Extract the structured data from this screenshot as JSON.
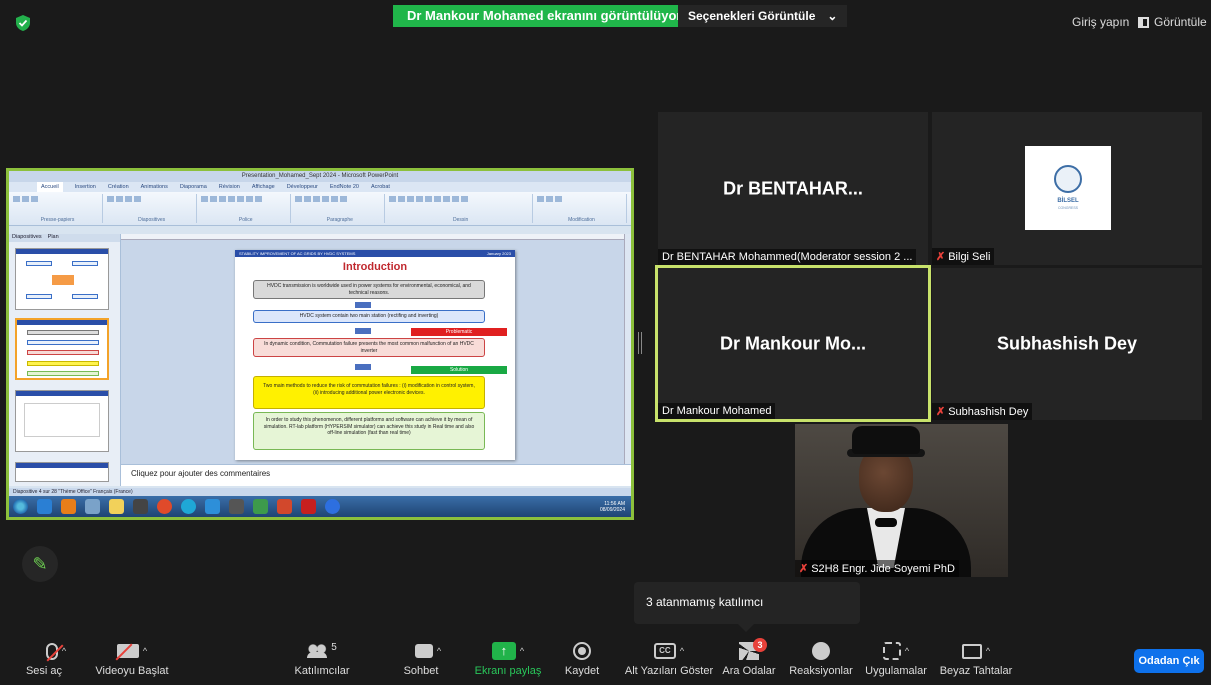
{
  "top_bar": {
    "share_banner": "Dr Mankour Mohamed ekranını görüntülüyorsunuz",
    "view_options": "Seçenekleri Görüntüle",
    "sign_in": "Giriş yapın",
    "view": "Görüntüle"
  },
  "shared_screen": {
    "window_title": "Presentation_Mohamed_Sept 2024 - Microsoft PowerPoint",
    "ribbon_tabs": [
      "Accueil",
      "Insertion",
      "Création",
      "Animations",
      "Diaporama",
      "Révision",
      "Affichage",
      "Développeur",
      "EndNote 20",
      "Acrobat"
    ],
    "ribbon_groups": [
      "Presse-papiers",
      "Diapositives",
      "Police",
      "Paragraphe",
      "Dessin",
      "Modification"
    ],
    "panel_tabs": [
      "Diapositives",
      "Plan"
    ],
    "slide": {
      "header_left": "STABILITY IMPROVEMENT OF AC GRIDS BY HVDC SYSTEMS",
      "header_right": "January 2023",
      "title": "Introduction",
      "box1": "HVDC transmission is worldwide used in power systems  for environmental, economical, and technical reasons.",
      "box2": "HVDC system contain two main station (rectifing and inverting)",
      "tag_problem": "Problematic",
      "box3": "In dynamic condition, Commutation failure presents the most common malfunction of an HVDC inverter",
      "tag_solution": "Solution",
      "box4": "Two main methods  to reduce the risk of commutation failures : (i) modification in control system, (ii) introducing additional power electronic devices.",
      "box5": "In order to study this phenomenon, different platforms and software can achieve it by mean of simulation. RT-lab platform (HYPERSIM simulator) can achieve this study in Real time and also off-line simulation (fast than real time)"
    },
    "comment_placeholder": "Cliquez pour ajouter des commentaires",
    "status": "Diapositive 4 sur 28   \"Thème Office\"   Français (France)",
    "clock_time": "11:56 AM",
    "clock_date": "08/09/2024"
  },
  "participants": [
    {
      "tile_label": "Dr  BENTAHAR...",
      "name": "Dr BENTAHAR Mohammed(Moderator session 2 ...",
      "muted": false
    },
    {
      "tile_label": "",
      "name": "Bilgi Seli",
      "muted": true,
      "logo_text": "BİLSEL",
      "logo_sub": "CONGRESS"
    },
    {
      "tile_label": "Dr  Mankour Mo...",
      "name": "Dr Mankour Mohamed",
      "muted": false,
      "active_speaker": true
    },
    {
      "tile_label": "Subhashish Dey",
      "name": "Subhashish Dey",
      "muted": true
    },
    {
      "tile_label": "",
      "name": "S2H8 Engr. Jide Soyemi PhD",
      "muted": true,
      "video": true
    }
  ],
  "tooltip": "3 atanmamış katılımcı",
  "toolbar": {
    "mute": "Sesi aç",
    "video": "Videoyu Başlat",
    "participants": "Katılımcılar",
    "participants_count": "5",
    "chat": "Sohbet",
    "share": "Ekranı paylaş",
    "record": "Kaydet",
    "captions": "Alt Yazıları Göster",
    "breakout": "Ara Odalar",
    "breakout_badge": "3",
    "reactions": "Reaksiyonlar",
    "apps": "Uygulamalar",
    "whiteboards": "Beyaz Tahtalar",
    "leave": "Odadan Çık",
    "cc_glyph": "CC"
  },
  "colors": {
    "share_green": "#20b64a",
    "active_border": "#c8e26b",
    "leave_blue": "#0e71eb",
    "muted_red": "#e8413a"
  }
}
